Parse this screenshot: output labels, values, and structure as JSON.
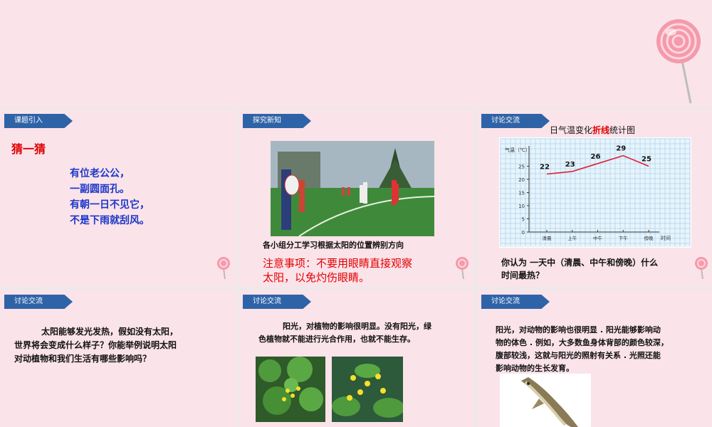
{
  "slide1": {
    "tag": "课题引入",
    "title": "猜一猜",
    "riddle": [
      "有位老公公，",
      "一副圆面孔。",
      "有朝一日不见它，",
      "不是下雨就刮风。"
    ]
  },
  "slide2": {
    "tag": "探究新知",
    "caption": "各小组分工学习根据太阳的位置辨别方向",
    "note": [
      "注意事项：不要用眼睛直接观察",
      "太阳，以免灼伤眼睛。"
    ]
  },
  "slide3": {
    "tag": "讨论交流",
    "question": [
      "你认为 一天中（清晨、中午和傍晚）什么",
      "时间最热？"
    ]
  },
  "chart_data": {
    "type": "line",
    "title_prefix": "日气温变化",
    "title_highlight": "折线",
    "title_suffix": "统计图",
    "ylabel": "气温（℃）",
    "xlabel": "时间",
    "categories": [
      "清晨",
      "上午",
      "中午",
      "下午",
      "傍晚"
    ],
    "values": [
      22,
      23,
      26,
      29,
      25
    ],
    "y_ticks": [
      0,
      5,
      10,
      15,
      20,
      25
    ],
    "ylim": [
      0,
      30
    ],
    "grid": true,
    "line_color": "#e0203a"
  },
  "slide4": {
    "tag": "讨论交流",
    "text": [
      "太阳能够发光发热，假如没有太阳，",
      "世界将会变成什么样子？你能举例说明太阳",
      "对动植物和我们生活有哪些影响吗？"
    ]
  },
  "slide5": {
    "tag": "讨论交流",
    "text": [
      "阳光，对植物的影响很明显。没有阳光，绿",
      "色植物就不能进行光合作用，也就不能生存。"
    ]
  },
  "slide6": {
    "tag": "讨论交流",
    "text": [
      "阳光，对动物的影响也很明显 . 阳光能够影响动",
      "物的体色 . 例如，大多数鱼身体背部的颜色较深，",
      "腹部较浅，这就与阳光的照射有关系 . 光照还能",
      "影响动物的生长发育。"
    ]
  },
  "colors": {
    "tag_blue": "#2f63a8",
    "slide_pink": "#fbe3ea",
    "title_red": "#e00000",
    "text_blue": "#1c36c9"
  }
}
